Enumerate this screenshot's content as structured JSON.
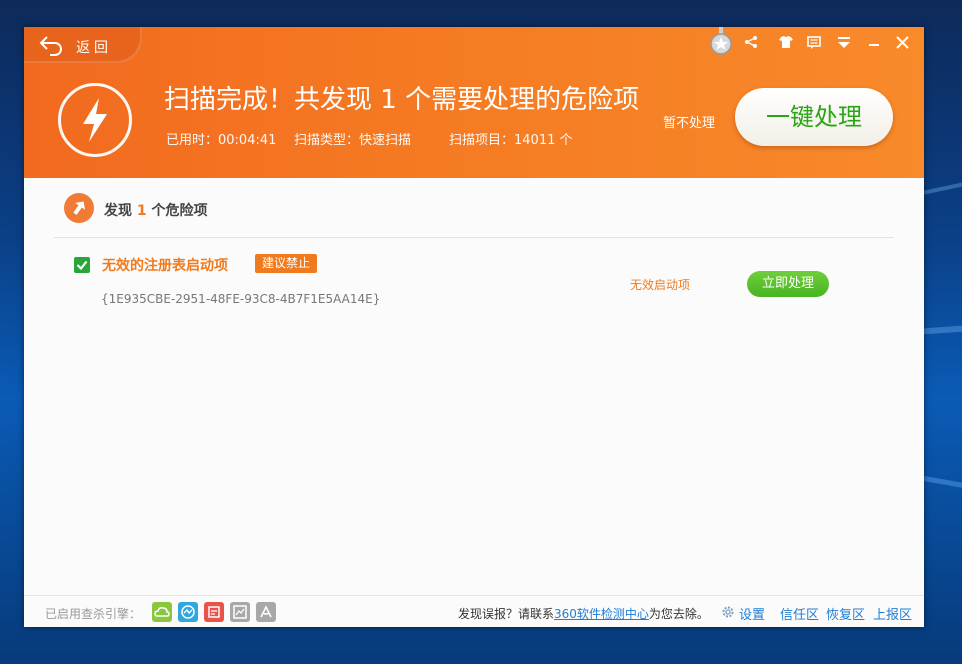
{
  "header": {
    "back_label": "返回",
    "title": "扫描完成！共发现 1 个需要处理的危险项",
    "elapsed": "已用时：00:04:41",
    "scan_type": "扫描类型：快速扫描",
    "scan_items": "扫描项目：14011 个",
    "skip_label": "暂不处理",
    "onekey_label": "一键处理",
    "icons": [
      "medal-icon",
      "share-icon",
      "shirt-icon",
      "message-icon",
      "menu-icon",
      "minimize-icon",
      "close-icon"
    ]
  },
  "results": {
    "found_prefix": "发现",
    "found_count": "1",
    "found_suffix": "个危险项",
    "items": [
      {
        "title": "无效的注册表启动项",
        "tag": "建议禁止",
        "guid": "{1E935CBE-2951-48FE-93C8-4B7F1E5AA14E}",
        "type": "无效启动项",
        "action": "立即处理",
        "checked": true
      }
    ]
  },
  "footer": {
    "engines_label": "已启用查杀引擎：",
    "engines": [
      {
        "name": "cloud-engine-icon",
        "color": "#8cc63f"
      },
      {
        "name": "qvm-engine-icon",
        "color": "#2fa8e0"
      },
      {
        "name": "qex-engine-icon",
        "color": "#e8534a"
      },
      {
        "name": "kunpeng-engine-icon",
        "color": "#a8a8a8"
      },
      {
        "name": "avira-engine-icon",
        "color": "#a8a8a8"
      }
    ],
    "report_prefix": "发现误报？请联系",
    "report_link": "360软件检测中心",
    "report_suffix": "为您去除。",
    "settings": "设置",
    "trust": "信任区",
    "restore": "恢复区",
    "upload": "上报区"
  },
  "colors": {
    "accent": "#f26a1f",
    "green": "#2aa615",
    "link": "#1f7ed6"
  }
}
